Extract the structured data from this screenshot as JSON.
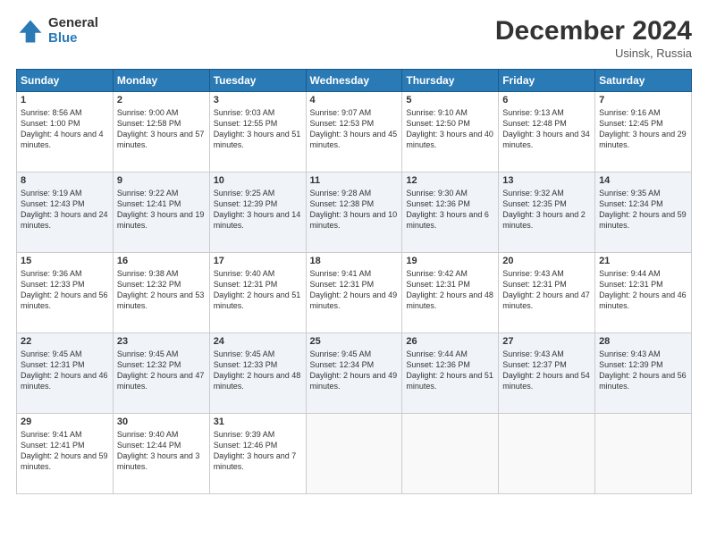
{
  "logo": {
    "general": "General",
    "blue": "Blue"
  },
  "header": {
    "month": "December 2024",
    "location": "Usinsk, Russia"
  },
  "weekdays": [
    "Sunday",
    "Monday",
    "Tuesday",
    "Wednesday",
    "Thursday",
    "Friday",
    "Saturday"
  ],
  "weeks": [
    [
      {
        "day": "1",
        "sunrise": "8:56 AM",
        "sunset": "1:00 PM",
        "daylight": "4 hours and 4 minutes."
      },
      {
        "day": "2",
        "sunrise": "9:00 AM",
        "sunset": "12:58 PM",
        "daylight": "3 hours and 57 minutes."
      },
      {
        "day": "3",
        "sunrise": "9:03 AM",
        "sunset": "12:55 PM",
        "daylight": "3 hours and 51 minutes."
      },
      {
        "day": "4",
        "sunrise": "9:07 AM",
        "sunset": "12:53 PM",
        "daylight": "3 hours and 45 minutes."
      },
      {
        "day": "5",
        "sunrise": "9:10 AM",
        "sunset": "12:50 PM",
        "daylight": "3 hours and 40 minutes."
      },
      {
        "day": "6",
        "sunrise": "9:13 AM",
        "sunset": "12:48 PM",
        "daylight": "3 hours and 34 minutes."
      },
      {
        "day": "7",
        "sunrise": "9:16 AM",
        "sunset": "12:45 PM",
        "daylight": "3 hours and 29 minutes."
      }
    ],
    [
      {
        "day": "8",
        "sunrise": "9:19 AM",
        "sunset": "12:43 PM",
        "daylight": "3 hours and 24 minutes."
      },
      {
        "day": "9",
        "sunrise": "9:22 AM",
        "sunset": "12:41 PM",
        "daylight": "3 hours and 19 minutes."
      },
      {
        "day": "10",
        "sunrise": "9:25 AM",
        "sunset": "12:39 PM",
        "daylight": "3 hours and 14 minutes."
      },
      {
        "day": "11",
        "sunrise": "9:28 AM",
        "sunset": "12:38 PM",
        "daylight": "3 hours and 10 minutes."
      },
      {
        "day": "12",
        "sunrise": "9:30 AM",
        "sunset": "12:36 PM",
        "daylight": "3 hours and 6 minutes."
      },
      {
        "day": "13",
        "sunrise": "9:32 AM",
        "sunset": "12:35 PM",
        "daylight": "3 hours and 2 minutes."
      },
      {
        "day": "14",
        "sunrise": "9:35 AM",
        "sunset": "12:34 PM",
        "daylight": "2 hours and 59 minutes."
      }
    ],
    [
      {
        "day": "15",
        "sunrise": "9:36 AM",
        "sunset": "12:33 PM",
        "daylight": "2 hours and 56 minutes."
      },
      {
        "day": "16",
        "sunrise": "9:38 AM",
        "sunset": "12:32 PM",
        "daylight": "2 hours and 53 minutes."
      },
      {
        "day": "17",
        "sunrise": "9:40 AM",
        "sunset": "12:31 PM",
        "daylight": "2 hours and 51 minutes."
      },
      {
        "day": "18",
        "sunrise": "9:41 AM",
        "sunset": "12:31 PM",
        "daylight": "2 hours and 49 minutes."
      },
      {
        "day": "19",
        "sunrise": "9:42 AM",
        "sunset": "12:31 PM",
        "daylight": "2 hours and 48 minutes."
      },
      {
        "day": "20",
        "sunrise": "9:43 AM",
        "sunset": "12:31 PM",
        "daylight": "2 hours and 47 minutes."
      },
      {
        "day": "21",
        "sunrise": "9:44 AM",
        "sunset": "12:31 PM",
        "daylight": "2 hours and 46 minutes."
      }
    ],
    [
      {
        "day": "22",
        "sunrise": "9:45 AM",
        "sunset": "12:31 PM",
        "daylight": "2 hours and 46 minutes."
      },
      {
        "day": "23",
        "sunrise": "9:45 AM",
        "sunset": "12:32 PM",
        "daylight": "2 hours and 47 minutes."
      },
      {
        "day": "24",
        "sunrise": "9:45 AM",
        "sunset": "12:33 PM",
        "daylight": "2 hours and 48 minutes."
      },
      {
        "day": "25",
        "sunrise": "9:45 AM",
        "sunset": "12:34 PM",
        "daylight": "2 hours and 49 minutes."
      },
      {
        "day": "26",
        "sunrise": "9:44 AM",
        "sunset": "12:36 PM",
        "daylight": "2 hours and 51 minutes."
      },
      {
        "day": "27",
        "sunrise": "9:43 AM",
        "sunset": "12:37 PM",
        "daylight": "2 hours and 54 minutes."
      },
      {
        "day": "28",
        "sunrise": "9:43 AM",
        "sunset": "12:39 PM",
        "daylight": "2 hours and 56 minutes."
      }
    ],
    [
      {
        "day": "29",
        "sunrise": "9:41 AM",
        "sunset": "12:41 PM",
        "daylight": "2 hours and 59 minutes."
      },
      {
        "day": "30",
        "sunrise": "9:40 AM",
        "sunset": "12:44 PM",
        "daylight": "3 hours and 3 minutes."
      },
      {
        "day": "31",
        "sunrise": "9:39 AM",
        "sunset": "12:46 PM",
        "daylight": "3 hours and 7 minutes."
      },
      null,
      null,
      null,
      null
    ]
  ]
}
